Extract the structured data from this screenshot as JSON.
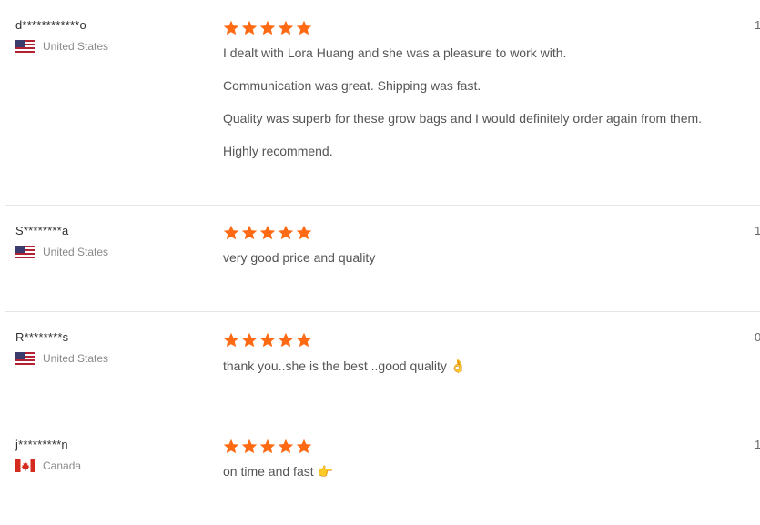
{
  "reviews": [
    {
      "name": "d************o",
      "country": "United States",
      "flag": "us",
      "rating": 5,
      "lines": [
        "I dealt with Lora  Huang and she was a pleasure to work with.",
        "Communication was great. Shipping was fast.",
        "Quality was superb for these grow bags and I would definitely order again from them.",
        "Highly recommend."
      ],
      "side": "1"
    },
    {
      "name": "S********a",
      "country": "United States",
      "flag": "us",
      "rating": 5,
      "lines": [
        "very good price and quality"
      ],
      "side": "1"
    },
    {
      "name": "R********s",
      "country": "United States",
      "flag": "us",
      "rating": 5,
      "lines": [
        "thank you..she is the best ..good quality 👌"
      ],
      "side": "0"
    },
    {
      "name": "j*********n",
      "country": "Canada",
      "flag": "ca",
      "rating": 5,
      "lines": [
        "on time and fast 👉"
      ],
      "side": "1"
    }
  ],
  "colors": {
    "star": "#ff6a13",
    "divider": "#e5e5e5"
  }
}
